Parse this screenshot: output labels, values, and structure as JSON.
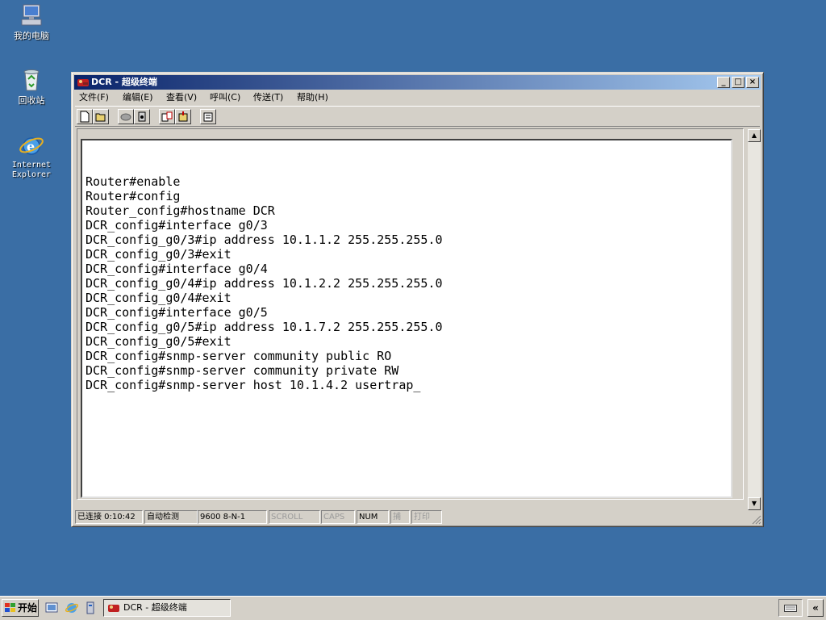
{
  "desktop": {
    "icons": [
      {
        "label": "我的电脑",
        "icon": "my-computer-icon"
      },
      {
        "label": "回收站",
        "icon": "recycle-bin-icon"
      },
      {
        "label": "Internet\nExplorer",
        "icon": "internet-explorer-icon"
      }
    ],
    "background_color": "#3a6ea5"
  },
  "window": {
    "title": "DCR - 超级终端",
    "controls": {
      "minimize": "_",
      "maximize": "□",
      "close": "×"
    },
    "menu": [
      "文件(F)",
      "编辑(E)",
      "查看(V)",
      "呼叫(C)",
      "传送(T)",
      "帮助(H)"
    ],
    "toolbar": [
      "new-icon",
      "open-icon",
      "disconnect-icon",
      "call-icon",
      "send-icon",
      "receive-icon",
      "properties-icon"
    ],
    "terminal_lines": [
      "",
      "Router#enable",
      "Router#config",
      "Router_config#hostname DCR",
      "DCR_config#interface g0/3",
      "DCR_config_g0/3#ip address 10.1.1.2 255.255.255.0",
      "DCR_config_g0/3#exit",
      "DCR_config#interface g0/4",
      "DCR_config_g0/4#ip address 10.1.2.2 255.255.255.0",
      "DCR_config_g0/4#exit",
      "DCR_config#interface g0/5",
      "DCR_config_g0/5#ip address 10.1.7.2 255.255.255.0",
      "DCR_config_g0/5#exit",
      "DCR_config#snmp-server community public RO",
      "DCR_config#snmp-server community private RW",
      "DCR_config#snmp-server host 10.1.4.2 usertrap_"
    ],
    "status": {
      "connected": "已连接 0:10:42",
      "detect": "自动检测",
      "baud": "9600 8-N-1",
      "scroll": "SCROLL",
      "caps": "CAPS",
      "num": "NUM",
      "capture": "捕",
      "print": "打印"
    }
  },
  "taskbar": {
    "start_label": "开始",
    "quick_launch": [
      "show-desktop-icon",
      "internet-explorer-icon",
      "server-manager-icon"
    ],
    "task_button": "DCR - 超级终端",
    "tray_arrow": "«",
    "tray_icon": "keyboard-icon"
  },
  "colors": {
    "title_active_start": "#0a246a",
    "title_active_end": "#a6caf0",
    "face": "#d4d0c8"
  }
}
